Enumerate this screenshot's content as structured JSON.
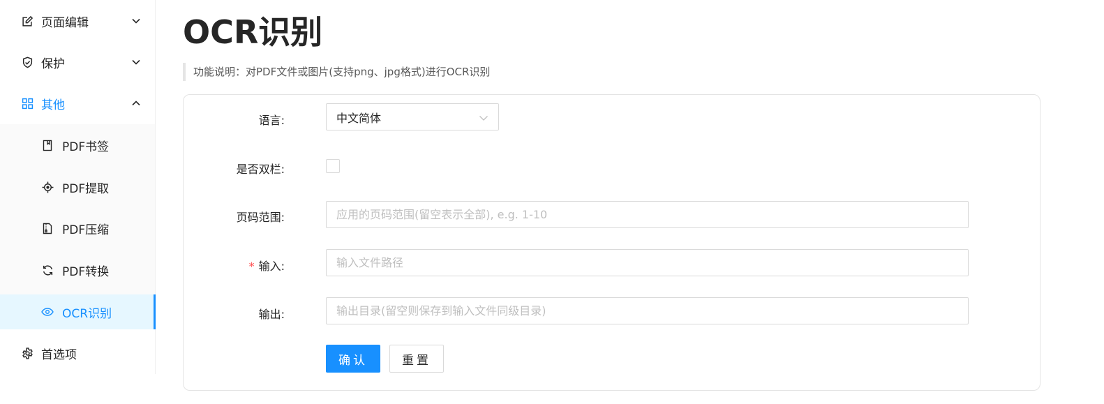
{
  "sidebar": {
    "items": [
      {
        "label": "页面编辑",
        "icon": "edit-icon"
      },
      {
        "label": "保护",
        "icon": "shield-icon"
      },
      {
        "label": "其他",
        "icon": "grid-icon"
      },
      {
        "label": "首选项",
        "icon": "gear-icon"
      }
    ],
    "subitems": [
      {
        "label": "PDF书签",
        "icon": "bookmark-icon"
      },
      {
        "label": "PDF提取",
        "icon": "target-icon"
      },
      {
        "label": "PDF压缩",
        "icon": "file-zip-icon"
      },
      {
        "label": "PDF转换",
        "icon": "sync-icon"
      },
      {
        "label": "OCR识别",
        "icon": "eye-icon"
      }
    ],
    "active": "OCR识别",
    "accent_color": "#1890ff"
  },
  "main": {
    "title": "OCR识别",
    "description": "功能说明：对PDF文件或图片(支持png、jpg格式)进行OCR识别",
    "form": {
      "language_label": "语言:",
      "language_value": "中文简体",
      "double_column_label": "是否双栏:",
      "double_column_checked": false,
      "page_range_label": "页码范围:",
      "page_range_placeholder": "应用的页码范围(留空表示全部), e.g. 1-10",
      "input_required_mark": "*",
      "input_label": "输入:",
      "input_placeholder": "输入文件路径",
      "output_label": "输出:",
      "output_placeholder": "输出目录(留空则保存到输入文件同级目录)",
      "confirm_label": "确认",
      "reset_label": "重置"
    }
  }
}
